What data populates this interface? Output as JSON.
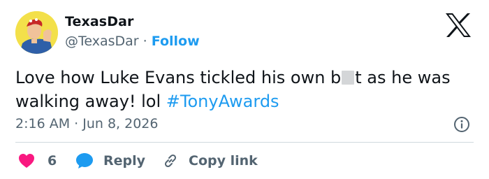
{
  "author": {
    "display_name": "TexasDar",
    "handle": "@TexasDar",
    "separator": " · ",
    "follow_label": "Follow"
  },
  "tweet": {
    "text_before": "Love how Luke Evans tickled his own b",
    "text_after": "t as he was walking away! lol ",
    "hashtag": "#TonyAwards"
  },
  "meta": {
    "time": "2:16 AM",
    "separator": " · ",
    "date": "Jun 8, 2026"
  },
  "actions": {
    "like_count": "6",
    "reply_label": "Reply",
    "copy_label": "Copy link"
  },
  "colors": {
    "accent": "#1d9bf0",
    "like": "#f91880",
    "text": "#0f1419",
    "muted": "#536471",
    "divider": "#cfd9de"
  },
  "icons": [
    "x-logo-icon",
    "info-icon",
    "heart-icon",
    "reply-bubble-icon",
    "link-icon"
  ]
}
